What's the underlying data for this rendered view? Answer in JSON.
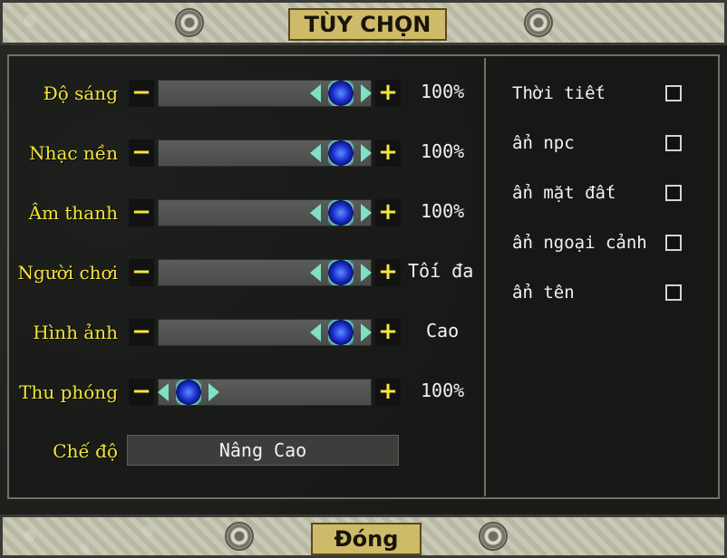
{
  "window": {
    "title": "TÙY CHỌN",
    "close_label": "Đóng"
  },
  "sliders": [
    {
      "label": "Độ sáng",
      "value_text": "100%",
      "level": 1.0
    },
    {
      "label": "Nhạc nền",
      "value_text": "100%",
      "level": 1.0
    },
    {
      "label": "Âm thanh",
      "value_text": "100%",
      "level": 1.0
    },
    {
      "label": "Người chơi",
      "value_text": "Tối đa",
      "level": 1.0
    },
    {
      "label": "Hình ảnh",
      "value_text": "Cao",
      "level": 1.0
    },
    {
      "label": "Thu phóng",
      "value_text": "100%",
      "level": 0.0
    }
  ],
  "mode": {
    "label": "Chế độ",
    "value": "Nâng Cao"
  },
  "toggles": [
    {
      "label": "Thời tiết",
      "checked": false
    },
    {
      "label": "ẩn npc",
      "checked": false
    },
    {
      "label": "ẩn mặt đất",
      "checked": false
    },
    {
      "label": "ẩn ngoại cảnh",
      "checked": false
    },
    {
      "label": "ẩn tên",
      "checked": false
    }
  ],
  "controls": {
    "minus": "−",
    "plus": "+"
  },
  "colors": {
    "label": "#f4e53a",
    "value": "#f2f2f2",
    "plate": "#cdbb6a"
  }
}
